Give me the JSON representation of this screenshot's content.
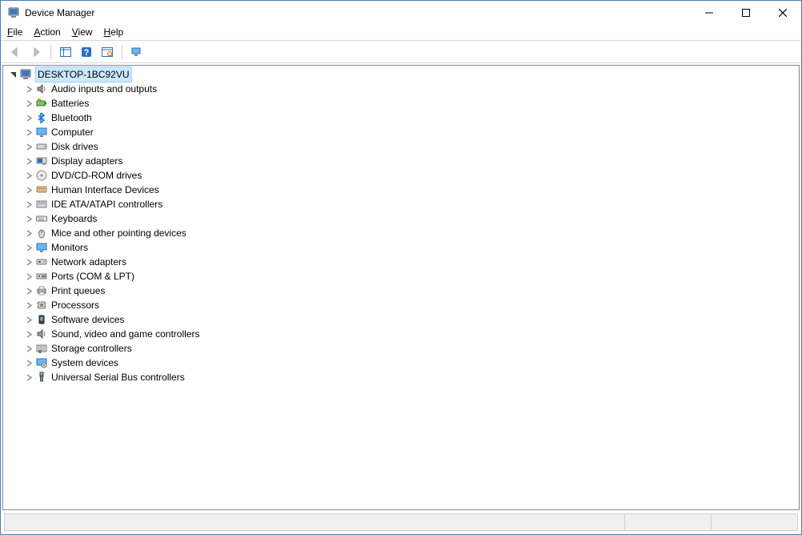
{
  "window": {
    "title": "Device Manager"
  },
  "menu": {
    "file": "File",
    "action": "Action",
    "view": "View",
    "help": "Help"
  },
  "tree": {
    "root": {
      "label": "DESKTOP-1BC92VU",
      "expanded": true,
      "icon": "computer"
    },
    "children": [
      {
        "label": "Audio inputs and outputs",
        "icon": "speaker"
      },
      {
        "label": "Batteries",
        "icon": "battery"
      },
      {
        "label": "Bluetooth",
        "icon": "bluetooth"
      },
      {
        "label": "Computer",
        "icon": "monitor"
      },
      {
        "label": "Disk drives",
        "icon": "disk"
      },
      {
        "label": "Display adapters",
        "icon": "display-adapter"
      },
      {
        "label": "DVD/CD-ROM drives",
        "icon": "optical"
      },
      {
        "label": "Human Interface Devices",
        "icon": "hid"
      },
      {
        "label": "IDE ATA/ATAPI controllers",
        "icon": "ide"
      },
      {
        "label": "Keyboards",
        "icon": "keyboard"
      },
      {
        "label": "Mice and other pointing devices",
        "icon": "mouse"
      },
      {
        "label": "Monitors",
        "icon": "monitor"
      },
      {
        "label": "Network adapters",
        "icon": "network"
      },
      {
        "label": "Ports (COM & LPT)",
        "icon": "ports"
      },
      {
        "label": "Print queues",
        "icon": "printer"
      },
      {
        "label": "Processors",
        "icon": "cpu"
      },
      {
        "label": "Software devices",
        "icon": "software"
      },
      {
        "label": "Sound, video and game controllers",
        "icon": "speaker"
      },
      {
        "label": "Storage controllers",
        "icon": "storage"
      },
      {
        "label": "System devices",
        "icon": "system"
      },
      {
        "label": "Universal Serial Bus controllers",
        "icon": "usb"
      }
    ]
  }
}
